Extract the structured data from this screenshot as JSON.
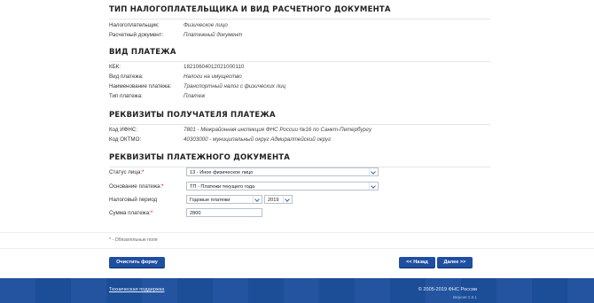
{
  "section1": {
    "title": "ТИП НАЛОГОПЛАТЕЛЬЩИКА И ВИД РАСЧЕТНОГО ДОКУМЕНТА",
    "rows": [
      {
        "label": "Налогоплательщик:",
        "value": "Физическое лицо"
      },
      {
        "label": "Расчетный документ:",
        "value": "Платежный документ"
      }
    ]
  },
  "section2": {
    "title": "ВИД ПЛАТЕЖА",
    "rows": [
      {
        "label": "КБК:",
        "value": "18210604012021000110"
      },
      {
        "label": "Вид платежа:",
        "value": "Налоги на имущество"
      },
      {
        "label": "Наименование платежа:",
        "value": "Транспортный налог с физических лиц"
      },
      {
        "label": "Тип платежа:",
        "value": "Платеж"
      }
    ]
  },
  "section3": {
    "title": "РЕКВИЗИТЫ ПОЛУЧАТЕЛЯ ПЛАТЕЖА",
    "rows": [
      {
        "label": "Код ИФНС:",
        "value": "7801 - Межрайонная инспекция ФНС России №16 по Санкт-Петербургу"
      },
      {
        "label": "Код ОКТМО:",
        "value": "40303000 - муниципальный округ Адмиралтейский округ"
      }
    ]
  },
  "section4": {
    "title": "РЕКВИЗИТЫ ПЛАТЕЖНОГО ДОКУМЕНТА",
    "status_label": "Статус лица:",
    "status_value": "13 - Иное физическое лицо",
    "basis_label": "Основание платежа:",
    "basis_value": "ТП - Платежи текущего года",
    "period_label": "Налоговый период",
    "period_value": "Годовые платежи",
    "year_value": "2019",
    "amount_label": "Сумма платежа:",
    "amount_value": "2800",
    "required_mark": "*"
  },
  "hint": "* - Обязательные поля",
  "buttons": {
    "clear": "Очистить форму",
    "back": "<< Назад",
    "next": "Далее >>"
  },
  "footer": {
    "support": "Техническая поддержка",
    "copyright": "© 2005-2019 ФНС России",
    "version": "Версия 2.5.1"
  },
  "colors": {
    "accent": "#1e4fa0",
    "footer": "#1d4f9c",
    "required": "#e00000"
  }
}
